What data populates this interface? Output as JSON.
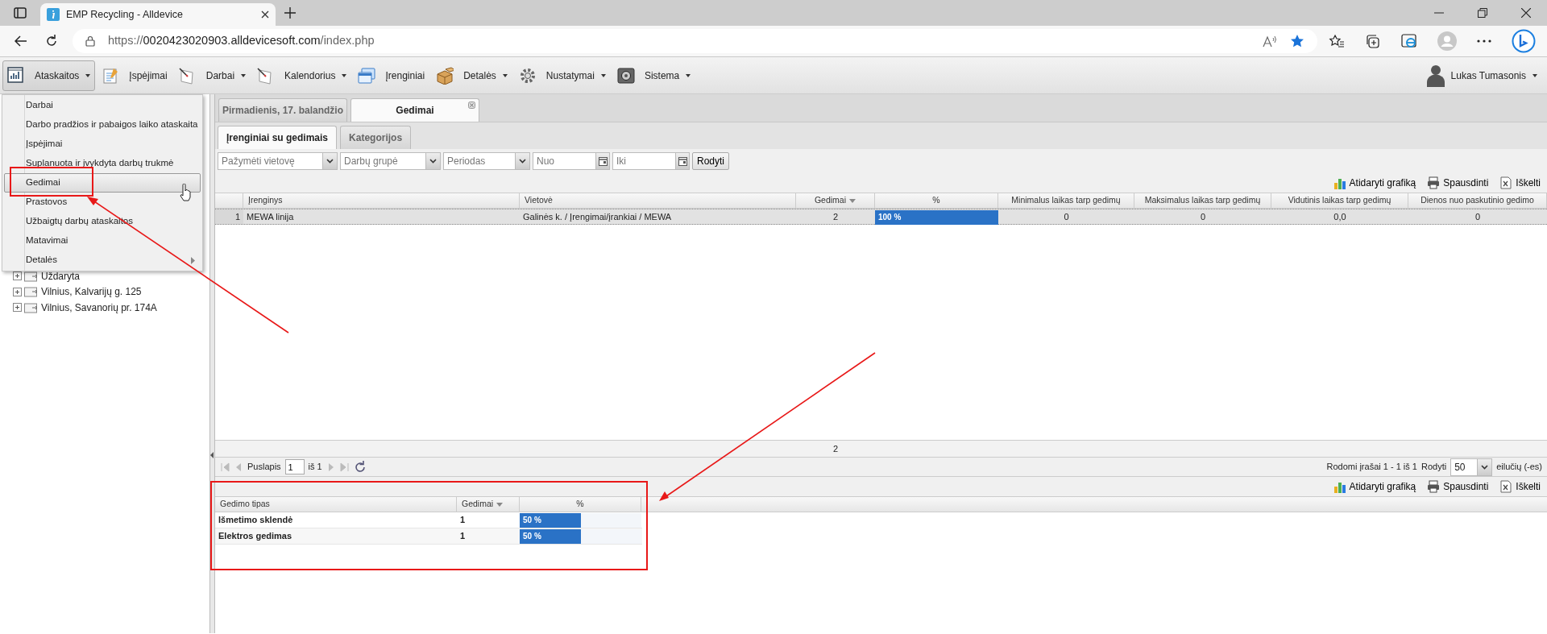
{
  "browser": {
    "tab_title": "EMP Recycling - Alldevice",
    "url_scheme": "https://",
    "url_host": "0020423020903.alldevicesoft.com",
    "url_path": "/index.php",
    "favorite": true
  },
  "toolbar": {
    "items": [
      {
        "label": "Ataskaitos",
        "dropdown": true,
        "selected": true
      },
      {
        "label": "Įspėjimai",
        "dropdown": false,
        "selected": false
      },
      {
        "label": "Darbai",
        "dropdown": true,
        "selected": false
      },
      {
        "label": "Kalendorius",
        "dropdown": true,
        "selected": false
      },
      {
        "label": "Įrenginiai",
        "dropdown": false,
        "selected": false
      },
      {
        "label": "Detalės",
        "dropdown": true,
        "selected": false
      },
      {
        "label": "Nustatymai",
        "dropdown": true,
        "selected": false
      },
      {
        "label": "Sistema",
        "dropdown": true,
        "selected": false
      }
    ],
    "user": "Lukas Tumasonis"
  },
  "menu": {
    "items": [
      {
        "label": "Darbai",
        "selected": false,
        "submenu": false
      },
      {
        "label": "Darbo pradžios ir pabaigos laiko ataskaita",
        "selected": false,
        "submenu": false
      },
      {
        "label": "Įspėjimai",
        "selected": false,
        "submenu": false
      },
      {
        "label": "Suplanuota ir įvykdyta darbų trukmė",
        "selected": false,
        "submenu": false
      },
      {
        "label": "Gedimai",
        "selected": true,
        "submenu": false
      },
      {
        "label": "Prastovos",
        "selected": false,
        "submenu": false
      },
      {
        "label": "Užbaigtų darbų ataskaitos",
        "selected": false,
        "submenu": false
      },
      {
        "label": "Matavimai",
        "selected": false,
        "submenu": false
      },
      {
        "label": "Detalės",
        "selected": false,
        "submenu": true
      }
    ]
  },
  "tree": {
    "items": [
      {
        "label": "Uždaryta"
      },
      {
        "label": "Vilnius, Kalvarijų g. 125"
      },
      {
        "label": "Vilnius, Savanorių pr. 174A"
      }
    ]
  },
  "tabs": [
    {
      "label": "Pirmadienis, 17. balandžio",
      "selected": false,
      "closable": false
    },
    {
      "label": "Gedimai",
      "selected": true,
      "closable": true
    }
  ],
  "subtabs": [
    {
      "label": "Įrenginiai su gedimais",
      "selected": true
    },
    {
      "label": "Kategorijos",
      "selected": false
    }
  ],
  "filters": {
    "selects": [
      {
        "placeholder": "Pažymėti vietovę"
      },
      {
        "placeholder": "Darbų grupė"
      },
      {
        "placeholder": "Periodas"
      }
    ],
    "dates": [
      {
        "placeholder": "Nuo"
      },
      {
        "placeholder": "Iki"
      }
    ],
    "button": "Rodyti"
  },
  "actions": [
    "Atidaryti grafiką",
    "Spausdinti",
    "Iškelti"
  ],
  "table": {
    "columns": [
      {
        "label": "Įrenginys",
        "sorted": false
      },
      {
        "label": "Vietovė",
        "sorted": false
      },
      {
        "label": "Gedimai",
        "sorted": true
      },
      {
        "label": "%",
        "sorted": false
      },
      {
        "label": "Minimalus laikas tarp gedimų",
        "sorted": false
      },
      {
        "label": "Maksimalus laikas tarp gedimų",
        "sorted": false
      },
      {
        "label": "Vidutinis laikas tarp gedimų",
        "sorted": false
      },
      {
        "label": "Dienos nuo paskutinio gedimo",
        "sorted": false
      }
    ],
    "rows": [
      {
        "number": "1",
        "device": "MEWA linija",
        "location": "Galinės k. / Įrengimai/įrankiai / MEWA",
        "failures": "2",
        "percent": "100 %",
        "level": 1,
        "min": "0",
        "max": "0",
        "avg": "0,0",
        "days": "0",
        "selected": true
      }
    ],
    "summary": "2"
  },
  "pager": {
    "page_label": "Puslapis",
    "page": "1",
    "of": "iš 1",
    "records": "Rodomi įrašai 1 - 1 iš 1",
    "show_label": "Rodyti",
    "page_size": "50",
    "unit": "eilučių (-es)"
  },
  "actions_2": [
    "Atidaryti grafiką",
    "Spausdinti",
    "Iškelti"
  ],
  "table_2": {
    "columns": [
      {
        "label": "Gedimo tipas",
        "sorted": false
      },
      {
        "label": "Gedimai",
        "sorted": true
      },
      {
        "label": "%",
        "sorted": false
      }
    ],
    "rows": [
      {
        "type": "Išmetimo sklendė",
        "failures": "1",
        "percent": "50 %",
        "level": 0.5
      },
      {
        "type": "Elektros gedimas",
        "failures": "1",
        "percent": "50 %",
        "level": 0.5
      }
    ]
  }
}
